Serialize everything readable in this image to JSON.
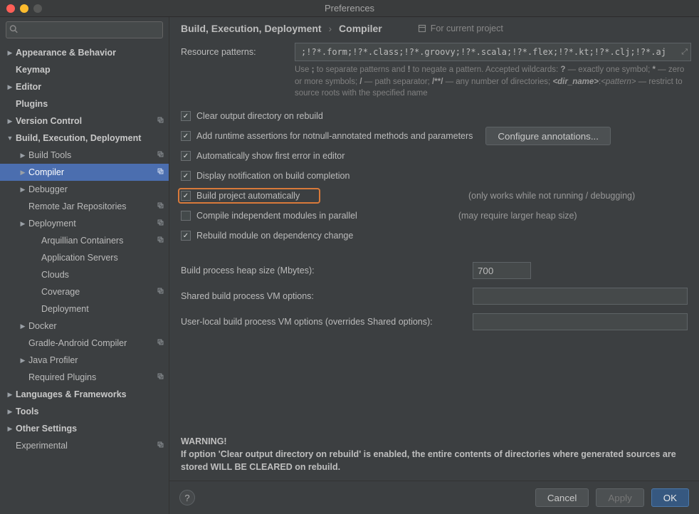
{
  "window": {
    "title": "Preferences"
  },
  "search": {
    "placeholder": ""
  },
  "sidebar": {
    "items": [
      {
        "label": "Appearance & Behavior",
        "depth": 0,
        "arrow": "closed",
        "bold": true
      },
      {
        "label": "Keymap",
        "depth": 0,
        "arrow": "none",
        "bold": true
      },
      {
        "label": "Editor",
        "depth": 0,
        "arrow": "closed",
        "bold": true
      },
      {
        "label": "Plugins",
        "depth": 0,
        "arrow": "none",
        "bold": true
      },
      {
        "label": "Version Control",
        "depth": 0,
        "arrow": "closed",
        "bold": true,
        "proj": true
      },
      {
        "label": "Build, Execution, Deployment",
        "depth": 0,
        "arrow": "open",
        "bold": true
      },
      {
        "label": "Build Tools",
        "depth": 1,
        "arrow": "closed",
        "proj": true
      },
      {
        "label": "Compiler",
        "depth": 1,
        "arrow": "closed",
        "proj": true,
        "selected": true
      },
      {
        "label": "Debugger",
        "depth": 1,
        "arrow": "closed"
      },
      {
        "label": "Remote Jar Repositories",
        "depth": 1,
        "arrow": "none",
        "proj": true
      },
      {
        "label": "Deployment",
        "depth": 1,
        "arrow": "closed",
        "proj": true
      },
      {
        "label": "Arquillian Containers",
        "depth": 2,
        "arrow": "none",
        "proj": true
      },
      {
        "label": "Application Servers",
        "depth": 2,
        "arrow": "none"
      },
      {
        "label": "Clouds",
        "depth": 2,
        "arrow": "none"
      },
      {
        "label": "Coverage",
        "depth": 2,
        "arrow": "none",
        "proj": true
      },
      {
        "label": "Deployment",
        "depth": 2,
        "arrow": "none"
      },
      {
        "label": "Docker",
        "depth": 1,
        "arrow": "closed"
      },
      {
        "label": "Gradle-Android Compiler",
        "depth": 1,
        "arrow": "none",
        "proj": true
      },
      {
        "label": "Java Profiler",
        "depth": 1,
        "arrow": "closed"
      },
      {
        "label": "Required Plugins",
        "depth": 1,
        "arrow": "none",
        "proj": true
      },
      {
        "label": "Languages & Frameworks",
        "depth": 0,
        "arrow": "closed",
        "bold": true
      },
      {
        "label": "Tools",
        "depth": 0,
        "arrow": "closed",
        "bold": true
      },
      {
        "label": "Other Settings",
        "depth": 0,
        "arrow": "closed",
        "bold": true
      },
      {
        "label": "Experimental",
        "depth": 0,
        "arrow": "none",
        "proj": true
      }
    ]
  },
  "breadcrumb": {
    "part1": "Build, Execution, Deployment",
    "part2": "Compiler"
  },
  "for_project": "For current project",
  "resource": {
    "label": "Resource patterns:",
    "value": ";!?*.form;!?*.class;!?*.groovy;!?*.scala;!?*.flex;!?*.kt;!?*.clj;!?*.aj",
    "hint_html": "Use <b>;</b> to separate patterns and <b>!</b> to negate a pattern. Accepted wildcards: <b>?</b> — exactly one symbol; <b>*</b> — zero or more symbols; <b>/</b> — path separator; <b>/**/</b> — any number of directories; <b><i>&lt;dir_name&gt;</i></b>:<i>&lt;pattern&gt;</i> — restrict to source roots with the specified name"
  },
  "checks": {
    "c1": {
      "label": "Clear output directory on rebuild",
      "checked": true
    },
    "c2": {
      "label": "Add runtime assertions for notnull-annotated methods and parameters",
      "checked": true
    },
    "c3": {
      "label": "Automatically show first error in editor",
      "checked": true
    },
    "c4": {
      "label": "Display notification on build completion",
      "checked": true
    },
    "c5": {
      "label": "Build project automatically",
      "checked": true,
      "note": "(only works while not running / debugging)"
    },
    "c6": {
      "label": "Compile independent modules in parallel",
      "checked": false,
      "note": "(may require larger heap size)"
    },
    "c7": {
      "label": "Rebuild module on dependency change",
      "checked": true
    }
  },
  "configure_btn": "Configure annotations...",
  "fields": {
    "heap": {
      "label": "Build process heap size (Mbytes):",
      "value": "700"
    },
    "shared": {
      "label": "Shared build process VM options:",
      "value": ""
    },
    "userlocal": {
      "label": "User-local build process VM options (overrides Shared options):",
      "value": ""
    }
  },
  "warning": {
    "title": "WARNING!",
    "text": "If option 'Clear output directory on rebuild' is enabled, the entire contents of directories where generated sources are stored WILL BE CLEARED on rebuild."
  },
  "footer": {
    "cancel": "Cancel",
    "apply": "Apply",
    "ok": "OK"
  }
}
